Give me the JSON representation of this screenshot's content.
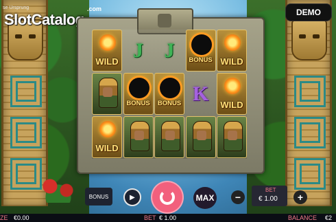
{
  "logo": {
    "subtitle": "se   Ursprung",
    "main": "SlotCatalog",
    "domain": ".com"
  },
  "demo_label": "DEMO",
  "reels": [
    [
      {
        "type": "wild",
        "label": "WILD"
      },
      {
        "type": "letter",
        "label": "J",
        "color": "#3fb356"
      },
      {
        "type": "letter",
        "label": "J",
        "color": "#3fb356"
      },
      {
        "type": "bonus",
        "label": "BONUS"
      },
      {
        "type": "wild",
        "label": "WILD"
      }
    ],
    [
      {
        "type": "warrior",
        "label": ""
      },
      {
        "type": "bonus",
        "label": "BONUS"
      },
      {
        "type": "bonus",
        "label": "BONUS"
      },
      {
        "type": "letter",
        "label": "K",
        "color": "#a561df"
      },
      {
        "type": "wild",
        "label": "WILD"
      }
    ],
    [
      {
        "type": "wild",
        "label": "WILD"
      },
      {
        "type": "warrior",
        "label": ""
      },
      {
        "type": "warrior",
        "label": ""
      },
      {
        "type": "warrior",
        "label": ""
      },
      {
        "type": "warrior",
        "label": ""
      }
    ]
  ],
  "controls": {
    "bonus_label": "BONUS",
    "max_label": "MAX",
    "minus_label": "−",
    "plus_label": "+",
    "bet_box_label": "BET",
    "bet_box_value": "€ 1.00"
  },
  "status": {
    "left_label": "ZE",
    "left_value": "€0.00",
    "bet_label": "BET",
    "bet_value": "€ 1.00",
    "balance_label": "BALANCE",
    "balance_value": "€2"
  },
  "colors": {
    "spin": "#f2607d",
    "accent_label": "#f47a8a"
  }
}
